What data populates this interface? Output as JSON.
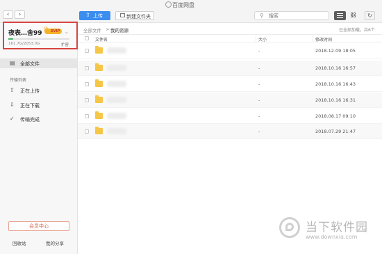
{
  "window": {
    "title": "百度网盘"
  },
  "toolbar": {
    "back_icon": "chevron-left-icon",
    "forward_icon": "chevron-right-icon",
    "upload_label": "上传",
    "new_folder_label": "新建文件夹",
    "search_placeholder": "搜索"
  },
  "account": {
    "username": "夜表…舍99",
    "vip_badge": "SVIP",
    "quota": "161.7G/2053.0G",
    "quota_fraction": 0.079,
    "expand_label": "扩容"
  },
  "sidebar": {
    "all_files_label": "全部文件",
    "transfer_section": "传输列表",
    "uploading_label": "正在上传",
    "downloading_label": "正在下载",
    "completed_label": "传输完成",
    "member_center_label": "会员中心",
    "recycle_bin_label": "回收站",
    "my_share_label": "我的分享"
  },
  "breadcrumb": {
    "root": "全部文件",
    "separator": ">",
    "current": "我的资源"
  },
  "status": {
    "loaded": "已全部加载，共6个"
  },
  "table": {
    "headers": {
      "name": "文件名",
      "size": "大小",
      "modified": "修改时间"
    },
    "rows": [
      {
        "size": "-",
        "modified": "2018.12.09 18:05"
      },
      {
        "size": "-",
        "modified": "2018.10.16 16:57"
      },
      {
        "size": "-",
        "modified": "2018.10.16 16:43"
      },
      {
        "size": "-",
        "modified": "2018.10.16 16:31"
      },
      {
        "size": "-",
        "modified": "2018.08.17 09:10"
      },
      {
        "size": "-",
        "modified": "2018.07.29 21:47"
      }
    ]
  },
  "watermark": {
    "text": "当下软件园",
    "url": "www.downxia.com"
  },
  "colors": {
    "accent": "#3b8df0",
    "folder": "#f6c646",
    "highlight": "#d6453f",
    "quota": "#4ab36b"
  }
}
